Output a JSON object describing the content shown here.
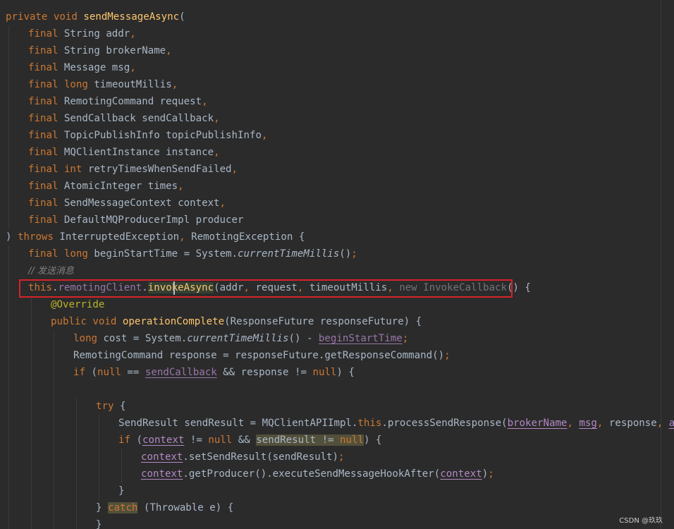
{
  "editor": {
    "language": "Java",
    "colors": {
      "background": "#2b2b2b",
      "keyword": "#cc7832",
      "method_declaration": "#ffc66d",
      "field": "#9876aa",
      "comment": "#808080",
      "annotation": "#bbb529",
      "highlight_box": "#d5232a"
    },
    "lines": [
      {
        "indent": 0,
        "tokens": [
          {
            "t": "private",
            "c": "kw"
          },
          {
            "t": " ",
            "c": "p"
          },
          {
            "t": "void",
            "c": "kw"
          },
          {
            "t": " ",
            "c": "p"
          },
          {
            "t": "sendMessageAsync",
            "c": "fn"
          },
          {
            "t": "(",
            "c": "p"
          }
        ]
      },
      {
        "indent": 1,
        "tokens": [
          {
            "t": "final",
            "c": "kw"
          },
          {
            "t": " String addr",
            "c": "id"
          },
          {
            "t": ",",
            "c": "kw"
          }
        ]
      },
      {
        "indent": 1,
        "tokens": [
          {
            "t": "final",
            "c": "kw"
          },
          {
            "t": " String brokerName",
            "c": "id"
          },
          {
            "t": ",",
            "c": "kw"
          }
        ]
      },
      {
        "indent": 1,
        "tokens": [
          {
            "t": "final",
            "c": "kw"
          },
          {
            "t": " Message msg",
            "c": "id"
          },
          {
            "t": ",",
            "c": "kw"
          }
        ]
      },
      {
        "indent": 1,
        "tokens": [
          {
            "t": "final",
            "c": "kw"
          },
          {
            "t": " ",
            "c": "p"
          },
          {
            "t": "long",
            "c": "kw"
          },
          {
            "t": " timeoutMillis",
            "c": "id"
          },
          {
            "t": ",",
            "c": "kw"
          }
        ]
      },
      {
        "indent": 1,
        "tokens": [
          {
            "t": "final",
            "c": "kw"
          },
          {
            "t": " RemotingCommand request",
            "c": "id"
          },
          {
            "t": ",",
            "c": "kw"
          }
        ]
      },
      {
        "indent": 1,
        "tokens": [
          {
            "t": "final",
            "c": "kw"
          },
          {
            "t": " SendCallback sendCallback",
            "c": "id"
          },
          {
            "t": ",",
            "c": "kw"
          }
        ]
      },
      {
        "indent": 1,
        "tokens": [
          {
            "t": "final",
            "c": "kw"
          },
          {
            "t": " TopicPublishInfo topicPublishInfo",
            "c": "id"
          },
          {
            "t": ",",
            "c": "kw"
          }
        ]
      },
      {
        "indent": 1,
        "tokens": [
          {
            "t": "final",
            "c": "kw"
          },
          {
            "t": " MQClientInstance instance",
            "c": "id"
          },
          {
            "t": ",",
            "c": "kw"
          }
        ]
      },
      {
        "indent": 1,
        "tokens": [
          {
            "t": "final",
            "c": "kw"
          },
          {
            "t": " ",
            "c": "p"
          },
          {
            "t": "int",
            "c": "kw"
          },
          {
            "t": " retryTimesWhenSendFailed",
            "c": "id"
          },
          {
            "t": ",",
            "c": "kw"
          }
        ]
      },
      {
        "indent": 1,
        "tokens": [
          {
            "t": "final",
            "c": "kw"
          },
          {
            "t": " AtomicInteger times",
            "c": "id"
          },
          {
            "t": ",",
            "c": "kw"
          }
        ]
      },
      {
        "indent": 1,
        "tokens": [
          {
            "t": "final",
            "c": "kw"
          },
          {
            "t": " SendMessageContext context",
            "c": "id"
          },
          {
            "t": ",",
            "c": "kw"
          }
        ]
      },
      {
        "indent": 1,
        "tokens": [
          {
            "t": "final",
            "c": "kw"
          },
          {
            "t": " DefaultMQProducerImpl producer",
            "c": "id"
          }
        ]
      },
      {
        "indent": 0,
        "tokens": [
          {
            "t": ") ",
            "c": "p"
          },
          {
            "t": "throws",
            "c": "kw"
          },
          {
            "t": " InterruptedException",
            "c": "id"
          },
          {
            "t": ",",
            "c": "kw"
          },
          {
            "t": " RemotingException {",
            "c": "id"
          }
        ]
      },
      {
        "indent": 1,
        "tokens": [
          {
            "t": "final",
            "c": "kw"
          },
          {
            "t": " ",
            "c": "p"
          },
          {
            "t": "long",
            "c": "kw"
          },
          {
            "t": " beginStartTime = System.",
            "c": "id"
          },
          {
            "t": "currentTimeMillis",
            "c": "st"
          },
          {
            "t": "()",
            "c": "p"
          },
          {
            "t": ";",
            "c": "kw"
          }
        ]
      },
      {
        "indent": 1,
        "tokens": [
          {
            "t": "// 发送消息",
            "c": "cm"
          }
        ]
      },
      {
        "indent": 1,
        "tokens": [
          {
            "t": "this",
            "c": "kw"
          },
          {
            "t": ".",
            "c": "p"
          },
          {
            "t": "remotingClient",
            "c": "field"
          },
          {
            "t": ".",
            "c": "p"
          },
          {
            "t": "invokeAsync",
            "c": "hl"
          },
          {
            "t": "(addr",
            "c": "id"
          },
          {
            "t": ",",
            "c": "kw"
          },
          {
            "t": " request",
            "c": "id"
          },
          {
            "t": ",",
            "c": "kw"
          },
          {
            "t": " timeoutMillis",
            "c": "id"
          },
          {
            "t": ",",
            "c": "kw"
          },
          {
            "t": " new InvokeCallback",
            "c": "grey"
          },
          {
            "t": "() {",
            "c": "p"
          }
        ]
      },
      {
        "indent": 2,
        "tokens": [
          {
            "t": "@Override",
            "c": "an"
          }
        ]
      },
      {
        "indent": 2,
        "tokens": [
          {
            "t": "public",
            "c": "kw"
          },
          {
            "t": " ",
            "c": "p"
          },
          {
            "t": "void",
            "c": "kw"
          },
          {
            "t": " ",
            "c": "p"
          },
          {
            "t": "operationComplete",
            "c": "fn"
          },
          {
            "t": "(ResponseFuture responseFuture) {",
            "c": "id"
          }
        ]
      },
      {
        "indent": 3,
        "tokens": [
          {
            "t": "long",
            "c": "kw"
          },
          {
            "t": " cost = System.",
            "c": "id"
          },
          {
            "t": "currentTimeMillis",
            "c": "st"
          },
          {
            "t": "() - ",
            "c": "p"
          },
          {
            "t": "beginStartTime",
            "c": "fldu"
          },
          {
            "t": ";",
            "c": "kw"
          }
        ]
      },
      {
        "indent": 3,
        "tokens": [
          {
            "t": "RemotingCommand response = responseFuture.getResponseCommand()",
            "c": "id"
          },
          {
            "t": ";",
            "c": "kw"
          }
        ]
      },
      {
        "indent": 3,
        "tokens": [
          {
            "t": "if",
            "c": "kw"
          },
          {
            "t": " (",
            "c": "p"
          },
          {
            "t": "null",
            "c": "kw"
          },
          {
            "t": " == ",
            "c": "p"
          },
          {
            "t": "sendCallback",
            "c": "fldu"
          },
          {
            "t": " && response != ",
            "c": "id"
          },
          {
            "t": "null",
            "c": "kw"
          },
          {
            "t": ") {",
            "c": "p"
          }
        ]
      },
      {
        "indent": 0,
        "tokens": []
      },
      {
        "indent": 4,
        "tokens": [
          {
            "t": "try",
            "c": "kw"
          },
          {
            "t": " {",
            "c": "p"
          }
        ]
      },
      {
        "indent": 5,
        "tokens": [
          {
            "t": "SendResult sendResult = MQClientAPIImpl.",
            "c": "id"
          },
          {
            "t": "this",
            "c": "kw"
          },
          {
            "t": ".processSendResponse(",
            "c": "id"
          },
          {
            "t": "brokerName",
            "c": "capu"
          },
          {
            "t": ",",
            "c": "kw"
          },
          {
            "t": " ",
            "c": "p"
          },
          {
            "t": "msg",
            "c": "capu"
          },
          {
            "t": ",",
            "c": "kw"
          },
          {
            "t": " response",
            "c": "id"
          },
          {
            "t": ",",
            "c": "kw"
          },
          {
            "t": " ",
            "c": "p"
          },
          {
            "t": "addr",
            "c": "capu"
          },
          {
            "t": ")",
            "c": "p"
          },
          {
            "t": ";",
            "c": "kw"
          }
        ]
      },
      {
        "indent": 5,
        "tokens": [
          {
            "t": "if",
            "c": "kw"
          },
          {
            "t": " (",
            "c": "p"
          },
          {
            "t": "context",
            "c": "capu"
          },
          {
            "t": " != ",
            "c": "p"
          },
          {
            "t": "null",
            "c": "kw"
          },
          {
            "t": " && ",
            "c": "p"
          },
          {
            "t": "sendResult != ",
            "c": "warn"
          },
          {
            "t": "null",
            "c": "kwwarn"
          },
          {
            "t": ") {",
            "c": "p"
          }
        ]
      },
      {
        "indent": 6,
        "tokens": [
          {
            "t": "context",
            "c": "capu"
          },
          {
            "t": ".setSendResult(sendResult)",
            "c": "id"
          },
          {
            "t": ";",
            "c": "kw"
          }
        ]
      },
      {
        "indent": 6,
        "tokens": [
          {
            "t": "context",
            "c": "capu"
          },
          {
            "t": ".getProducer().executeSendMessageHookAfter(",
            "c": "id"
          },
          {
            "t": "context",
            "c": "capu"
          },
          {
            "t": ")",
            "c": "p"
          },
          {
            "t": ";",
            "c": "kw"
          }
        ]
      },
      {
        "indent": 5,
        "tokens": [
          {
            "t": "}",
            "c": "p"
          }
        ]
      },
      {
        "indent": 4,
        "tokens": [
          {
            "t": "} ",
            "c": "p"
          },
          {
            "t": "catch",
            "c": "warn-kw"
          },
          {
            "t": " (Throwable e) {",
            "c": "id"
          }
        ]
      },
      {
        "indent": 4,
        "tokens": [
          {
            "t": "}",
            "c": "p"
          }
        ]
      }
    ]
  },
  "watermark": {
    "top_right": "",
    "bottom": "",
    "csdn": "CSDN @玖玖"
  }
}
